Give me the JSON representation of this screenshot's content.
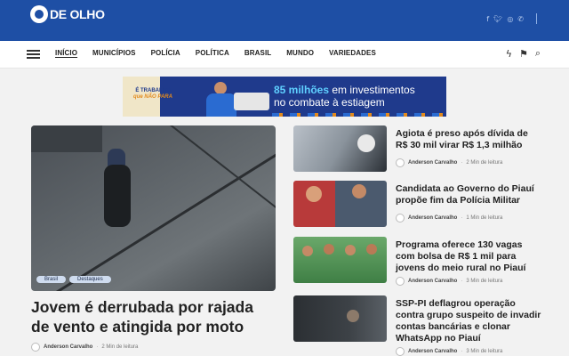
{
  "brand": {
    "logo_text": "DE OLHO"
  },
  "social": {
    "icons": [
      "facebook-icon",
      "twitter-icon",
      "instagram-icon",
      "whatsapp-icon"
    ]
  },
  "nav": {
    "items": [
      "INÍCIO",
      "MUNICÍPIOS",
      "POLÍCIA",
      "POLÍTICA",
      "BRASIL",
      "MUNDO",
      "VARIEDADES"
    ],
    "active_index": 0
  },
  "ad": {
    "brand_line1": "É TRABALHO",
    "brand_line2": "que NÃO PARA",
    "headline_highlight": "85 milhões",
    "headline_rest": " em investimentos",
    "headline_line2": "no combate à estiagem"
  },
  "feature": {
    "tags": [
      "Brasil",
      "Destaques"
    ],
    "title": "Jovem é derrubada por rajada de vento e atingida por moto",
    "author": "Anderson Carvalho",
    "separator": "·",
    "read_time": "2 Min de leitura"
  },
  "side_articles": [
    {
      "title": "Agiota é preso após dívida de R$ 30 mil virar R$ 1,3 milhão",
      "author": "Anderson Carvalho",
      "separator": "·",
      "read_time": "2 Min de leitura"
    },
    {
      "title": "Candidata ao Governo do Piauí propõe fim da Polícia Militar",
      "author": "Anderson Carvalho",
      "separator": "·",
      "read_time": "1 Min de leitura"
    },
    {
      "title": "Programa oferece 130 vagas com bolsa de R$ 1 mil para jovens do meio rural no Piauí",
      "author": "Anderson Carvalho",
      "separator": "·",
      "read_time": "3 Min de leitura"
    },
    {
      "title": "SSP-PI deflagrou operação contra grupo suspeito de invadir contas bancárias e clonar WhatsApp no Piauí",
      "author": "Anderson Carvalho",
      "separator": "·",
      "read_time": "3 Min de leitura"
    }
  ],
  "colors": {
    "header_bg": "#1e4fa5",
    "nav_bg": "#ffffff",
    "page_bg": "#f2f2f2",
    "tag_bg": "#cfdcef"
  }
}
